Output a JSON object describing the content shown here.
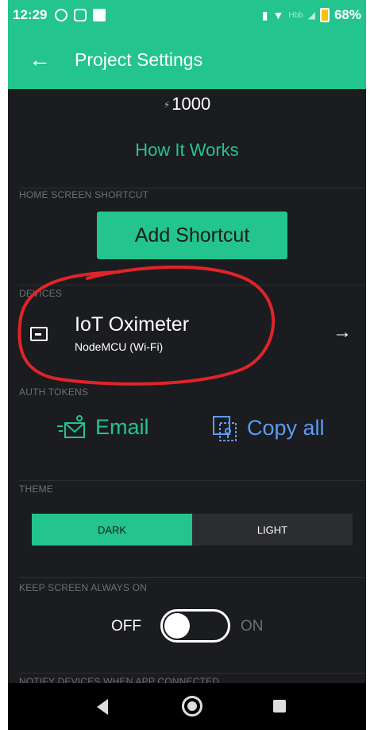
{
  "status_bar": {
    "time": "12:29",
    "battery": "68%",
    "network": "Hbb"
  },
  "app_bar": {
    "title": "Project Settings",
    "back_icon": "arrow-left-icon"
  },
  "energy": {
    "value": "1000",
    "icon": "bolt-icon"
  },
  "how_it_works": "How It Works",
  "home_shortcut": {
    "label": "HOME SCREEN SHORTCUT",
    "button": "Add Shortcut"
  },
  "devices": {
    "label": "DEVICES",
    "items": [
      {
        "name": "IoT Oximeter",
        "connection": "NodeMCU (Wi-Fi)",
        "icon": "device-board-icon"
      }
    ]
  },
  "auth_tokens": {
    "label": "AUTH TOKENS",
    "email": "Email",
    "copy_all": "Copy all"
  },
  "theme": {
    "label": "THEME",
    "options": [
      "DARK",
      "LIGHT"
    ],
    "selected": "DARK"
  },
  "keep_screen": {
    "label": "KEEP SCREEN ALWAYS ON",
    "off": "OFF",
    "on": "ON",
    "state": "off"
  },
  "notify": {
    "label": "NOTIFY DEVICES WHEN APP CONNECTED"
  },
  "colors": {
    "accent": "#23c48e",
    "background": "#1b1c1f",
    "link_blue": "#5a9cf7",
    "annotation_red": "#e0242a"
  }
}
